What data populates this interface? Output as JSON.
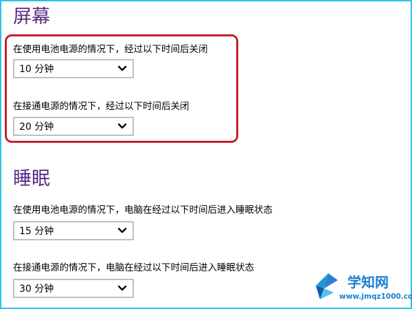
{
  "screen_section": {
    "title": "屏幕",
    "battery_label": "在使用电池电源的情况下，经过以下时间后关闭",
    "battery_value": "10 分钟",
    "plugged_label": "在接通电源的情况下，经过以下时间后关闭",
    "plugged_value": "20 分钟"
  },
  "sleep_section": {
    "title": "睡眠",
    "battery_label": "在使用电池电源的情况下，电脑在经过以下时间后进入睡眠状态",
    "battery_value": "15 分钟",
    "plugged_label": "在接通电源的情况下，电脑在经过以下时间后进入睡眠状态",
    "plugged_value": "30 分钟"
  },
  "watermark": {
    "brand": "学知网",
    "url": "www.jmqz1000.com"
  },
  "colors": {
    "section_title": "#5a2b86",
    "highlight_border": "#c71f2c",
    "window_border": "#29c3e6",
    "select_border": "#bfbfbf",
    "watermark_blue": "#1a7fd0"
  },
  "icons": {
    "dropdown": "chevron-down-icon",
    "watermark_logo": "logo-icon"
  }
}
